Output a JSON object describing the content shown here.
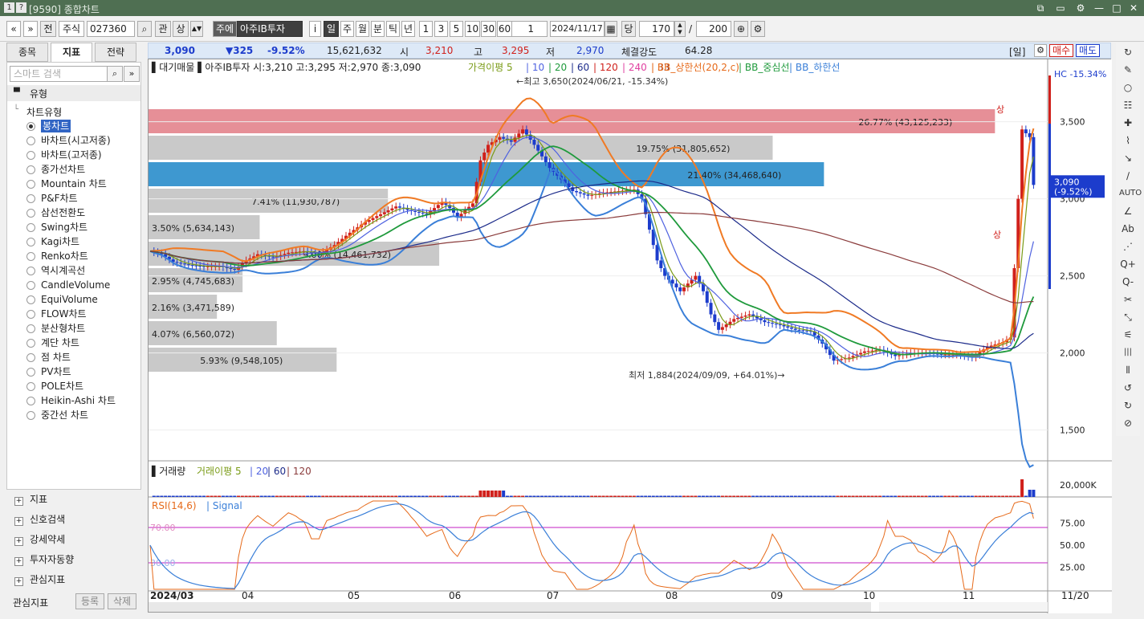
{
  "window": {
    "num": "1",
    "help": "?",
    "title": "[9590] 종합차트"
  },
  "toolbar": {
    "nav_prev": "«",
    "nav_down": "»",
    "jeon": "전",
    "market": "주식",
    "code": "027360",
    "gwan": "관",
    "sang": "상",
    "tag": "주에",
    "stock_name": "아주IB투자",
    "info": "i",
    "periods": [
      "일",
      "주",
      "월",
      "분",
      "틱",
      "년"
    ],
    "nums": [
      "1",
      "3",
      "5",
      "10",
      "30",
      "60"
    ],
    "unit": "1",
    "date": "2024/11/17",
    "dang": "당",
    "count": "170",
    "slash": "/",
    "total": "200"
  },
  "left_tabs": [
    "종목",
    "지표",
    "전략"
  ],
  "left": {
    "search_placeholder": "스마트 검색",
    "section": "유형",
    "tree_root": "차트유형",
    "items": [
      "봉차트",
      "바차트(시고저종)",
      "바차트(고저종)",
      "종가선차트",
      "Mountain 차트",
      "P&F차트",
      "삼선전환도",
      "Swing차트",
      "Kagi차트",
      "Renko차트",
      "역시계곡선",
      "CandleVolume",
      "EquiVolume",
      "FLOW차트",
      "분산형차트",
      "계단 차트",
      "점 차트",
      "PV차트",
      "POLE차트",
      "Heikin-Ashi 차트",
      "중간선 차트"
    ],
    "groups": [
      "지표",
      "신호검색",
      "강세약세",
      "투자자동향",
      "관심지표"
    ],
    "footer_label": "관심지표",
    "btn_add": "등록",
    "btn_del": "삭제"
  },
  "quote": {
    "price": "3,090",
    "change": "▼325",
    "rate": "-9.52%",
    "volume": "15,621,632",
    "open_label": "시",
    "open": "3,210",
    "high_label": "고",
    "high": "3,295",
    "low_label": "저",
    "low": "2,970",
    "strength_label": "체결강도",
    "strength": "64.28",
    "period_badge": "[일]",
    "buy": "매수",
    "sell": "매도"
  },
  "chart_data": {
    "type": "candlestick",
    "stock": "아주IB투자",
    "legend_main": "▌대기매물 ▌아주IB투자 시:3,210 고:3,295 저:2,970 종:3,090",
    "legend_ma": [
      "가격이평 5",
      "10",
      "20",
      "60",
      "120",
      "240",
      "33"
    ],
    "legend_bb": [
      "BB_상한선(20,2,c)",
      "BB_중심선",
      "BB_하한선"
    ],
    "hc_label": "HC -15.34%",
    "y_ticks": [
      "3,500",
      "3,000",
      "2,500",
      "2,000",
      "1,500"
    ],
    "price_tag": [
      "3,090",
      "(-9.52%)"
    ],
    "x_ticks": [
      "2024/03",
      "04",
      "05",
      "06",
      "07",
      "08",
      "09",
      "10",
      "11",
      "11/20"
    ],
    "annotation_high": "←최고 3,650(2024/06/21, -15.34%)",
    "annotation_low": "최저 1,884(2024/09/09, +64.01%)→",
    "signal_up": "상",
    "supply_bars": [
      {
        "label": "26.77% (43,125,233)",
        "w": 0.99,
        "color": "#e68f97"
      },
      {
        "label": "19.75% (31,805,652)",
        "w": 0.73,
        "color": "#c9c9c9"
      },
      {
        "label": "21.40% (34,468,640)",
        "w": 0.79,
        "color": "#3e98d0"
      },
      {
        "label": "7.41% (11,930,787)",
        "w": 0.28,
        "color": "#c9c9c9"
      },
      {
        "label": "3.50% (5,634,143)",
        "w": 0.13,
        "color": "#c9c9c9"
      },
      {
        "label": "9.00% (14,461,732)",
        "w": 0.34,
        "color": "#c9c9c9"
      },
      {
        "label": "2.95% (4,745,683)",
        "w": 0.11,
        "color": "#c9c9c9"
      },
      {
        "label": "2.16% (3,471,589)",
        "w": 0.08,
        "color": "#c9c9c9"
      },
      {
        "label": "4.07% (6,560,072)",
        "w": 0.15,
        "color": "#c9c9c9"
      },
      {
        "label": "5.93% (9,548,105)",
        "w": 0.22,
        "color": "#c9c9c9"
      }
    ],
    "close_path": [
      [
        0,
        2660
      ],
      [
        3,
        2640
      ],
      [
        6,
        2590
      ],
      [
        10,
        2570
      ],
      [
        14,
        2560
      ],
      [
        18,
        2560
      ],
      [
        22,
        2540
      ],
      [
        25,
        2600
      ],
      [
        28,
        2640
      ],
      [
        32,
        2620
      ],
      [
        36,
        2650
      ],
      [
        40,
        2660
      ],
      [
        44,
        2640
      ],
      [
        48,
        2700
      ],
      [
        52,
        2780
      ],
      [
        56,
        2850
      ],
      [
        60,
        2900
      ],
      [
        64,
        2950
      ],
      [
        68,
        2920
      ],
      [
        72,
        2900
      ],
      [
        76,
        2980
      ],
      [
        78,
        2940
      ],
      [
        80,
        2880
      ],
      [
        84,
        2970
      ],
      [
        86,
        3250
      ],
      [
        88,
        3350
      ],
      [
        91,
        3400
      ],
      [
        94,
        3370
      ],
      [
        97,
        3450
      ],
      [
        100,
        3350
      ],
      [
        104,
        3200
      ],
      [
        108,
        3100
      ],
      [
        110,
        3050
      ],
      [
        114,
        3020
      ],
      [
        118,
        3040
      ],
      [
        122,
        3050
      ],
      [
        126,
        3060
      ],
      [
        128,
        3000
      ],
      [
        130,
        2800
      ],
      [
        132,
        2600
      ],
      [
        134,
        2500
      ],
      [
        136,
        2450
      ],
      [
        138,
        2400
      ],
      [
        142,
        2500
      ],
      [
        144,
        2400
      ],
      [
        146,
        2250
      ],
      [
        148,
        2150
      ],
      [
        152,
        2220
      ],
      [
        156,
        2250
      ],
      [
        160,
        2200
      ],
      [
        164,
        2180
      ],
      [
        168,
        2150
      ],
      [
        172,
        2140
      ],
      [
        175,
        2060
      ],
      [
        178,
        1950
      ],
      [
        182,
        1970
      ],
      [
        186,
        2010
      ],
      [
        190,
        2020
      ],
      [
        194,
        1980
      ],
      [
        198,
        2000
      ],
      [
        202,
        2000
      ],
      [
        206,
        1990
      ],
      [
        210,
        1990
      ],
      [
        214,
        1970
      ],
      [
        218,
        2040
      ],
      [
        222,
        2070
      ],
      [
        224,
        2100
      ],
      [
        227,
        3450
      ],
      [
        229,
        3400
      ],
      [
        230,
        3090
      ]
    ],
    "x_range": [
      0,
      232
    ],
    "y_range": [
      1300,
      3800
    ],
    "volume_label": "거래량",
    "volume_legend": [
      "거래이평 5",
      "20",
      "60",
      "120"
    ],
    "volume_tick": "20,000K",
    "rsi_label": "RSI(14,6)",
    "signal_label": "Signal",
    "rsi_ticks": [
      "75.00",
      "50.00",
      "25.00"
    ],
    "rsi_levels": [
      "70.00",
      "30.00"
    ]
  },
  "right_tools": [
    "↻",
    "✎",
    "○",
    "☷",
    "✚",
    "⌇",
    "↘",
    "∕",
    "AUTO",
    "∠",
    "Ab",
    "⋰",
    "Q+",
    "Q-",
    "✂",
    "⤡",
    "⚟",
    "|||",
    "⦀",
    "↺",
    "↻",
    "⊘"
  ],
  "icons": {
    "search": "search-icon",
    "gear": "gear-icon",
    "close": "close-icon"
  },
  "colors": {
    "up": "#d0201b",
    "down": "#1c3ccc",
    "panel_blue": "#dde9f7",
    "title_green": "#4f6f52"
  }
}
